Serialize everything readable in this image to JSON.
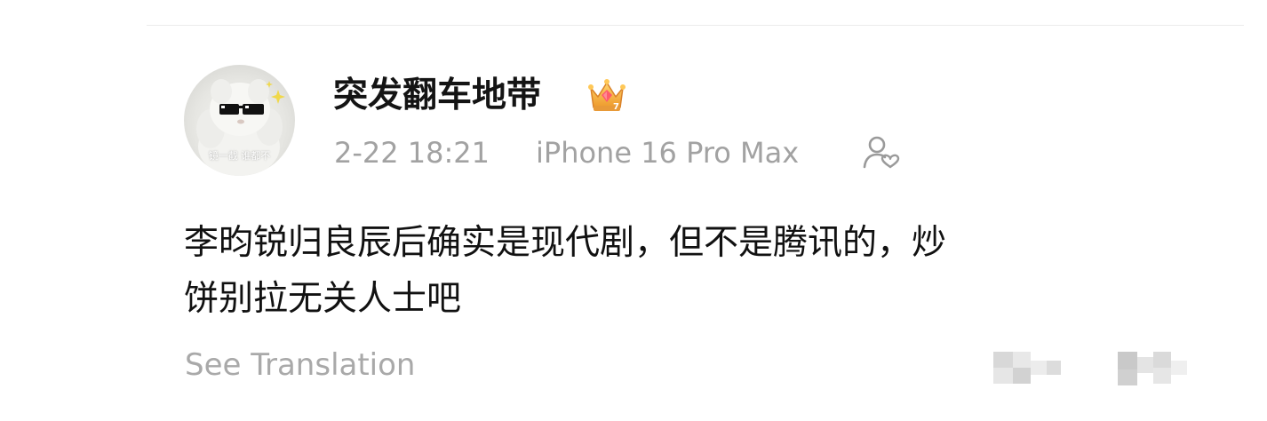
{
  "comment": {
    "username": "突发翻车地带",
    "avatar_caption": "镜一截 谁都不",
    "timestamp": "2-22 18:21",
    "device": "iPhone 16 Pro Max",
    "content_line1": "李昀锐归良辰后确实是现代剧，但不是腾讯的，炒",
    "content_line2": "饼别拉无关人士吧",
    "see_translation": "See Translation",
    "icons": {
      "badge": "crown-badge-icon",
      "follow": "user-follow-icon",
      "avatar": "plush-sunglasses-avatar"
    },
    "colors": {
      "username": "#141414",
      "meta": "#a2a2a2",
      "content": "#111111",
      "translation": "#a9a9a9",
      "crown": "#f2a93b"
    }
  }
}
